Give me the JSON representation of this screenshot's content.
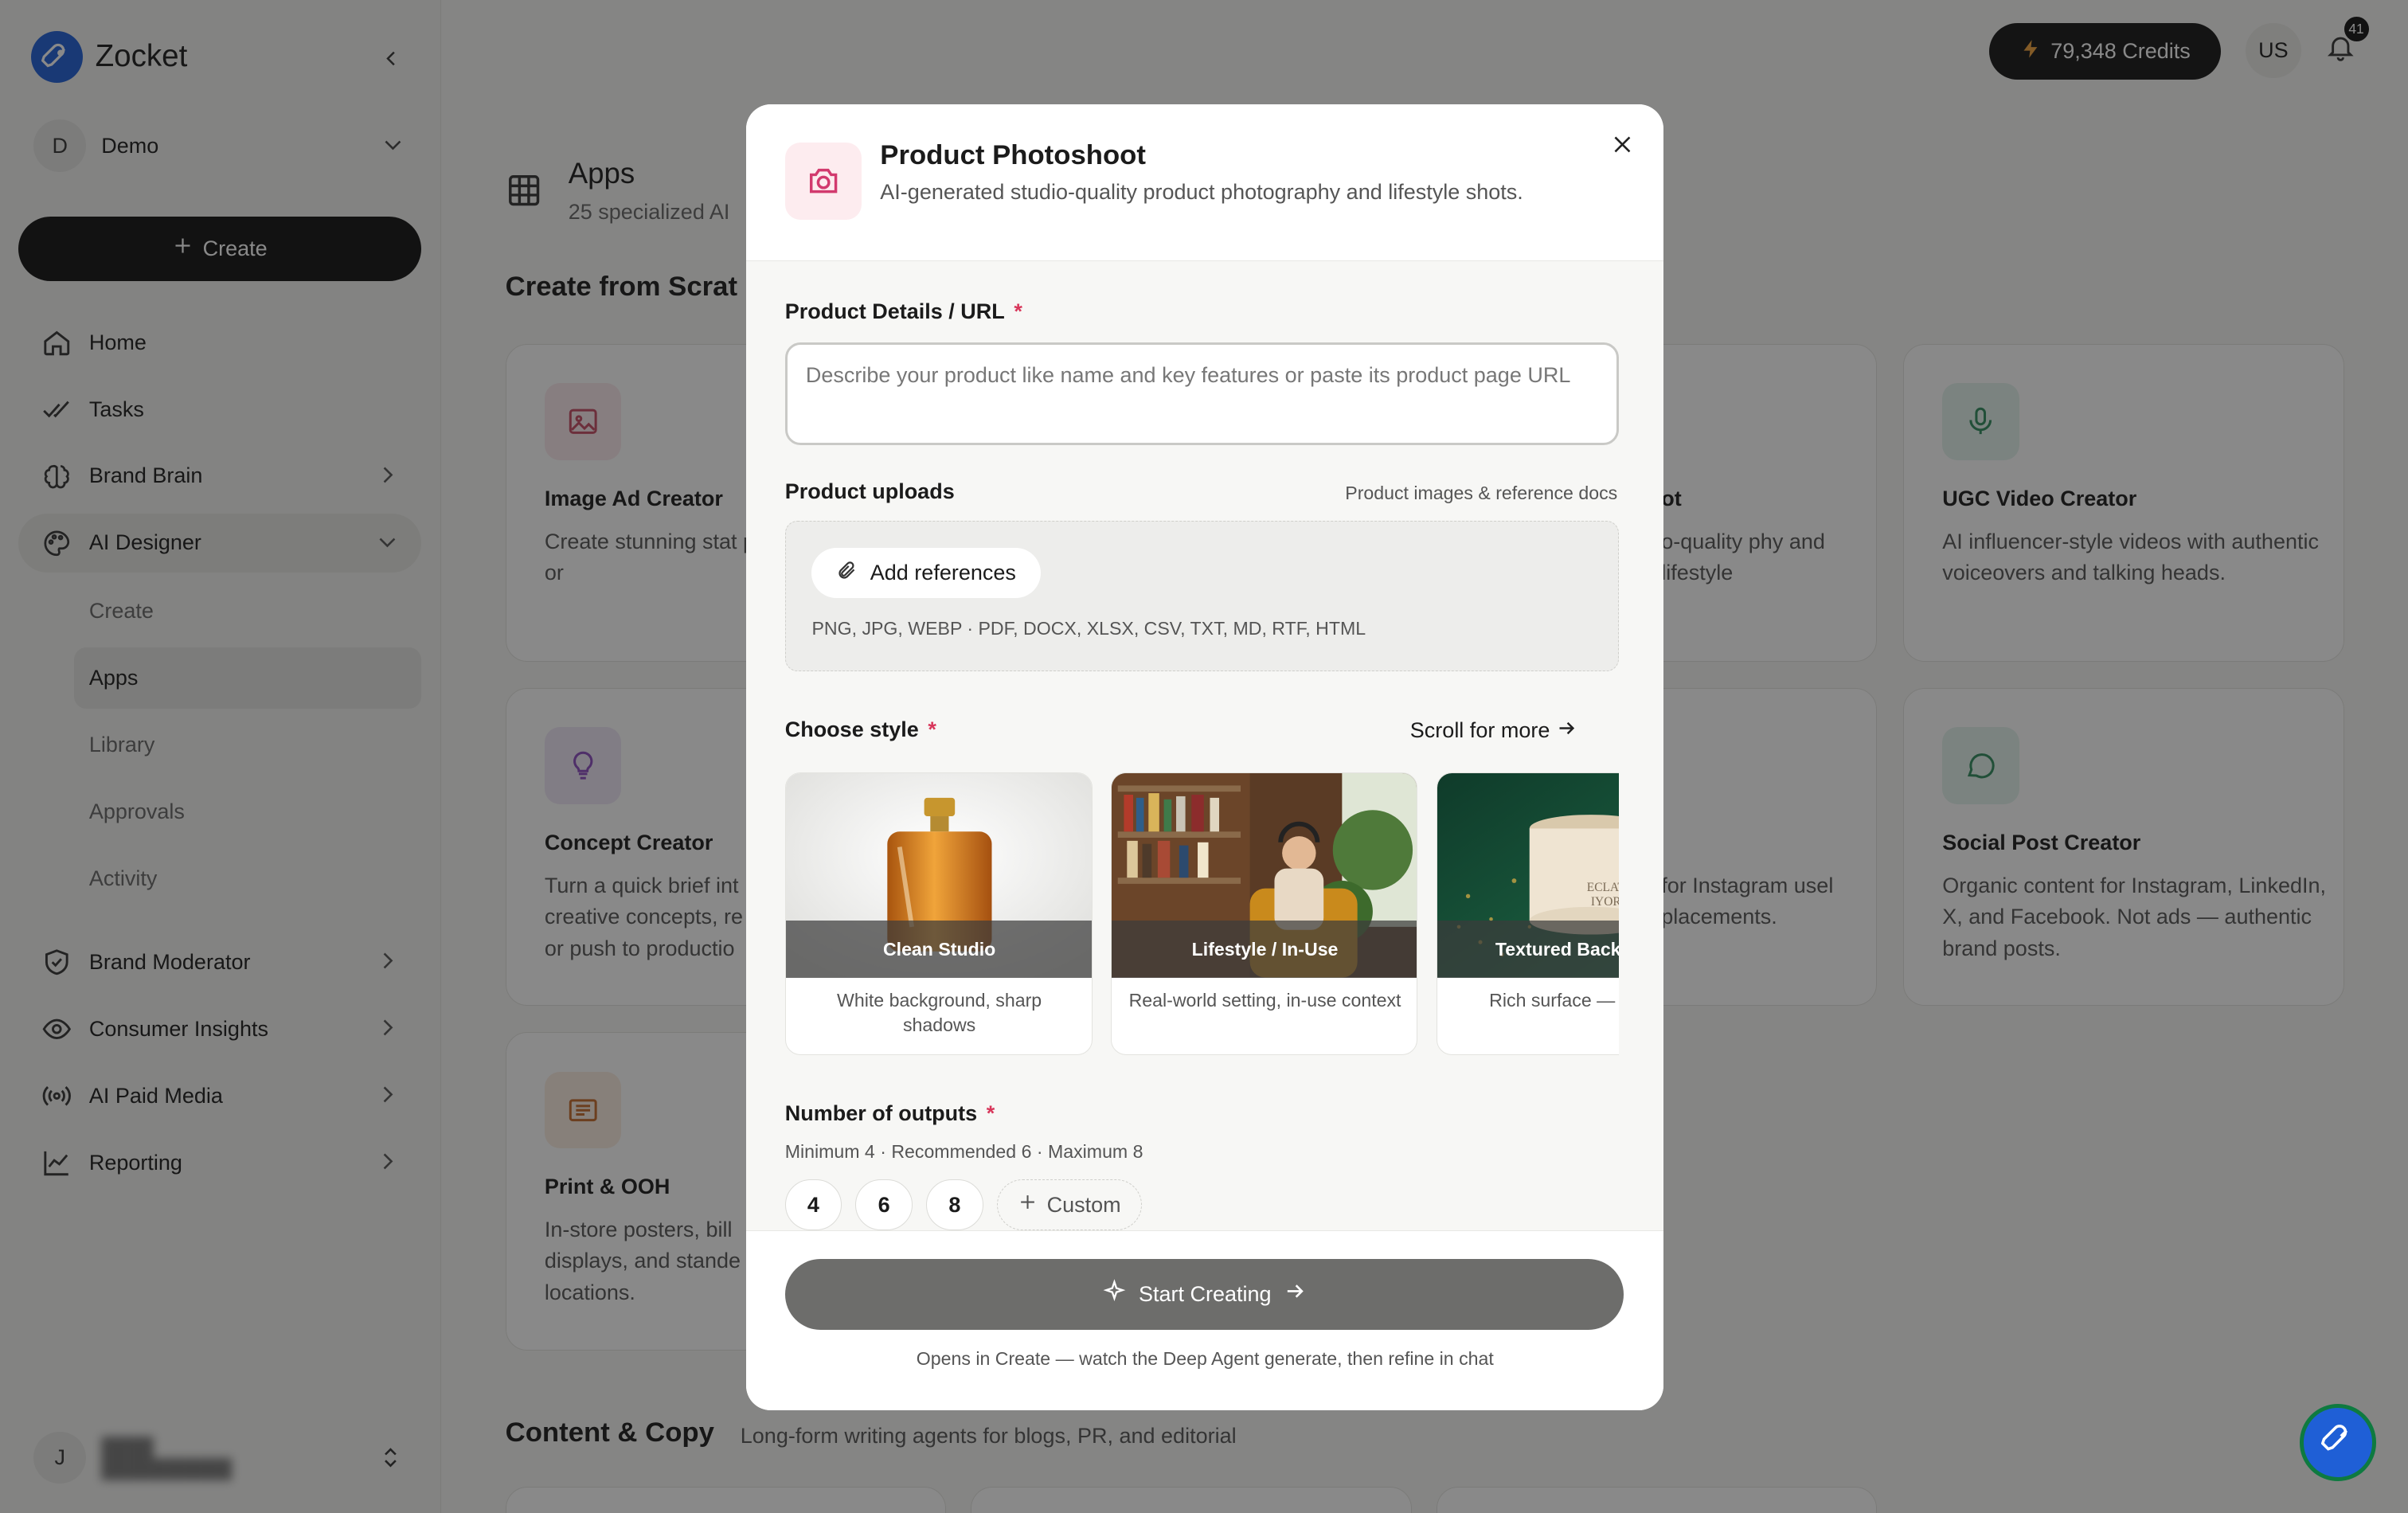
{
  "sidebar": {
    "brand": "Zocket",
    "workspace_initial": "D",
    "workspace_name": "Demo",
    "create_label": "Create",
    "nav": [
      {
        "label": "Home",
        "icon": "home-icon"
      },
      {
        "label": "Tasks",
        "icon": "check-double-icon"
      },
      {
        "label": "Brand Brain",
        "icon": "brain-icon"
      },
      {
        "label": "AI Designer",
        "icon": "palette-icon"
      }
    ],
    "sub": [
      "Create",
      "Apps",
      "Library",
      "Approvals",
      "Activity"
    ],
    "nav2": [
      {
        "label": "Brand Moderator",
        "icon": "shield-check-icon"
      },
      {
        "label": "Consumer Insights",
        "icon": "eye-icon"
      },
      {
        "label": "AI Paid Media",
        "icon": "broadcast-icon"
      },
      {
        "label": "Reporting",
        "icon": "line-chart-icon"
      }
    ],
    "user_initial": "J"
  },
  "topbar": {
    "credits": "79,348 Credits",
    "user": "US",
    "notifications": "41"
  },
  "main": {
    "title": "Apps",
    "subtitle": "25 specialized AI",
    "section1": "Create from Scrat",
    "section2": "Content & Copy",
    "section2_sub": "Long-form writing agents for blogs, PR, and editorial",
    "cards": [
      {
        "title": "Image Ad Creator",
        "desc": "Create stunning stat products, brands, or"
      },
      {
        "title": "ot",
        "desc": "o-quality phy and lifestyle"
      },
      {
        "title": "UGC Video Creator",
        "desc": "AI influencer-style videos with authentic voiceovers and talking heads."
      },
      {
        "title": "Concept Creator",
        "desc": "Turn a quick brief int creative concepts, re or push to productio"
      },
      {
        "title": "",
        "desc": "for Instagram usel placements."
      },
      {
        "title": "Social Post Creator",
        "desc": "Organic content for Instagram, LinkedIn, X, and Facebook. Not ads — authentic brand posts."
      },
      {
        "title": "Print & OOH",
        "desc": "In-store posters, bill displays, and stande locations."
      }
    ]
  },
  "modal": {
    "title": "Product Photoshoot",
    "subtitle": "AI-generated studio-quality product photography and lifestyle shots.",
    "details_label": "Product Details / URL",
    "req": "*",
    "details_placeholder": "Describe your product like name and key features or paste its product page URL",
    "uploads_label": "Product uploads",
    "uploads_hint": "Product images & reference docs",
    "add_ref": "Add references",
    "formats": "PNG, JPG, WEBP · PDF, DOCX, XLSX, CSV, TXT, MD, RTF, HTML",
    "style_label": "Choose style",
    "scroll_more": "Scroll for more",
    "styles": [
      {
        "name": "Clean Studio",
        "desc": "White background, sharp shadows"
      },
      {
        "name": "Lifestyle / In-Use",
        "desc": "Real-world setting, in-use context"
      },
      {
        "name": "Textured Back",
        "desc": "Rich surface — terrazzo, li"
      }
    ],
    "jar_label": "ECLAT IYOR",
    "outputs_label": "Number of outputs",
    "outputs_hint": "Minimum 4 · Recommended 6 · Maximum 8",
    "outputs": [
      "4",
      "6",
      "8"
    ],
    "custom": "Custom",
    "start": "Start Creating",
    "foot_hint": "Opens in Create — watch the Deep Agent generate, then refine in chat"
  },
  "colors": {
    "accent_blue": "#1f5fd6",
    "required_red": "#d8365a",
    "start_button": "#6d6d6b"
  }
}
